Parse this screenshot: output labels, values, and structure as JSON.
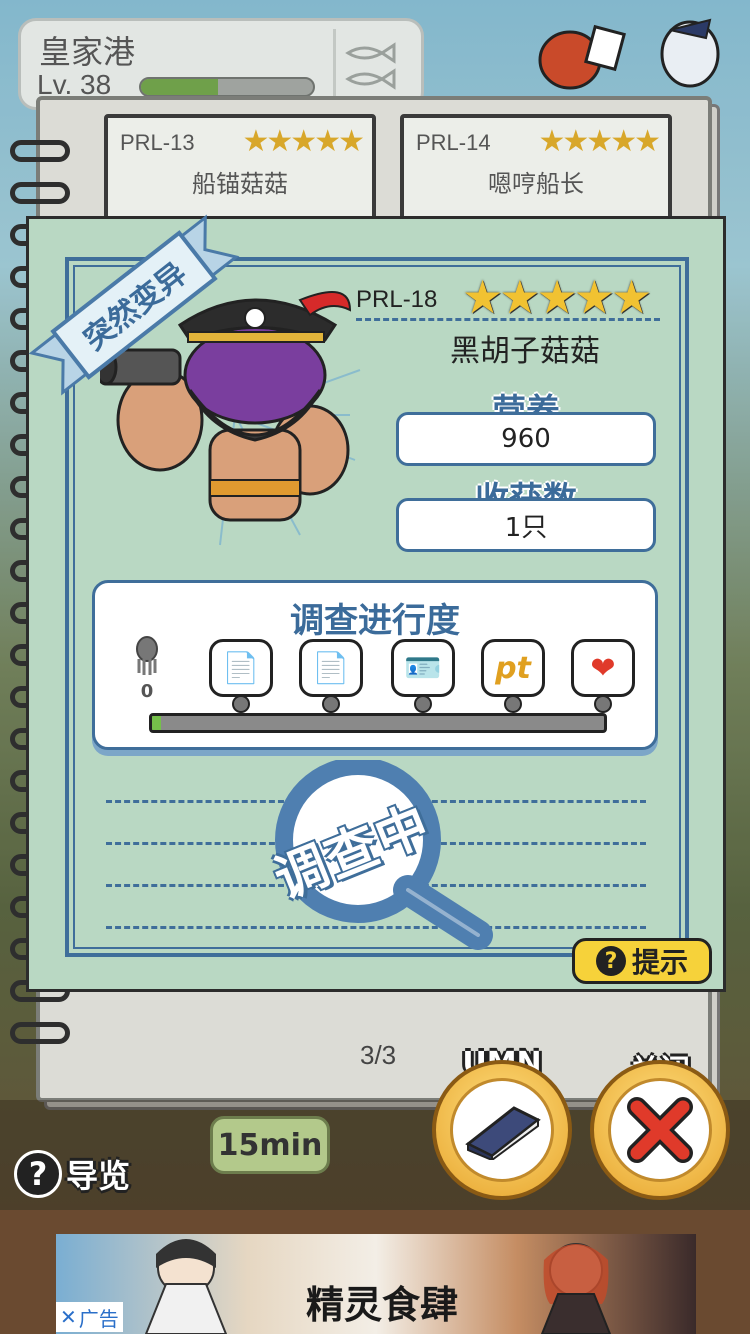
{
  "header": {
    "port_name": "皇家港",
    "level_label": "Lv. 38",
    "level_progress": 0.45,
    "fish_icon": "fish-icon"
  },
  "background_cards": [
    {
      "code": "PRL-13",
      "stars": "★★★★★",
      "name": "船锚菇菇"
    },
    {
      "code": "PRL-14",
      "stars": "★★★★★",
      "name": "嗯哼船长"
    }
  ],
  "page_indicator": "3/3",
  "timer_label": "15min",
  "detail": {
    "mutation_label": "突然变异",
    "code": "PRL-18",
    "stars": "★★★★★",
    "star_count": 5,
    "name": "黑胡子菇菇",
    "nutrition_label": "营养",
    "nutrition_value": "960",
    "harvest_label": "收获数",
    "harvest_value": "1只",
    "progress": {
      "title": "调查进行度",
      "count": "0",
      "fill": 0.02,
      "steps": [
        {
          "icon": "document-icon",
          "glyph": "📄"
        },
        {
          "icon": "document-icon",
          "glyph": "📄"
        },
        {
          "icon": "id-card-icon",
          "glyph": "🪪"
        },
        {
          "icon": "points-icon",
          "glyph": "pt"
        },
        {
          "icon": "heart-icon",
          "glyph": "❤"
        }
      ]
    },
    "status_stamp": "调查中",
    "hint_label": "提示"
  },
  "buttons": {
    "umn_label": "UMN",
    "close_label": "关闭",
    "guide_label": "导览"
  },
  "ad": {
    "logo_text": "精灵食肆",
    "tag_label": "广告",
    "tag_close": "✕"
  },
  "colors": {
    "modal_bg": "#b9d8c3",
    "accent_blue": "#3f6e9a",
    "star_gold": "#f1c232",
    "hint_yellow": "#f6d23a",
    "close_red": "#e03a2a"
  }
}
